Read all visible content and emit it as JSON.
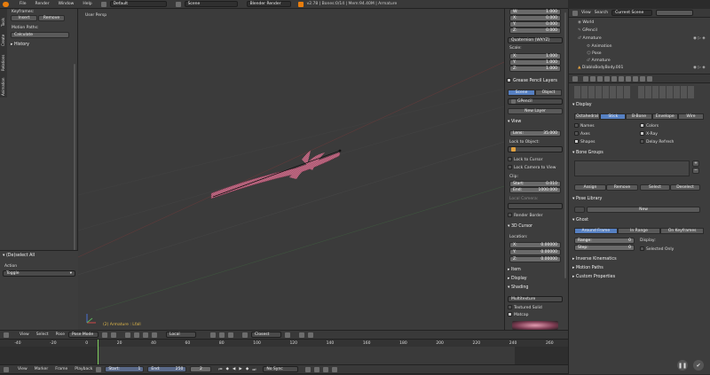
{
  "info_bar": {
    "menu": [
      "File",
      "Render",
      "Window",
      "Help"
    ],
    "layout_name": "Default",
    "scene_name": "Scene",
    "render_engine": "Blender Render",
    "stats": "v2.78 | Bones:0/14 | Mem:94.40M | Armature"
  },
  "tool_shelf": {
    "keyframes_label": "Keyframes:",
    "insert": "Insert",
    "remove": "Remove",
    "motion_paths_label": "Motion Paths:",
    "calculate": "Calculate",
    "history": "History",
    "tabs": [
      "Tools",
      "Create",
      "Relations",
      "Animation"
    ]
  },
  "operator_panel": {
    "title": "(De)select All",
    "action_label": "Action",
    "action_value": "Toggle"
  },
  "viewport": {
    "label": "User Persp",
    "object_label": "(2) Armature : Lfall"
  },
  "properties_n": {
    "rot_w": "W:",
    "rot_w_val": "1.000",
    "rot_x": "X:",
    "rot_x_val": "0.000",
    "rot_y": "Y:",
    "rot_y_val": "0.000",
    "rot_z": "Z:",
    "rot_z_val": "0.000",
    "rotation_mode": "Quaternion (WXYZ)",
    "scale_label": "Scale:",
    "scale_x": "X:",
    "scale_x_val": "1.000",
    "scale_y": "Y:",
    "scale_y_val": "1.000",
    "scale_z": "Z:",
    "scale_z_val": "1.000",
    "grease_pencil": "Grease Pencil Layers",
    "scene_tab": "Scene",
    "object_tab": "Object",
    "gpencil_name": "GPencil",
    "new_layer": "New Layer",
    "view_section": "View",
    "lens_label": "Lens:",
    "lens_value": "35.000",
    "lock_to_object": "Lock to Object:",
    "lock_to_cursor": "Lock to Cursor",
    "lock_camera": "Lock Camera to View",
    "clip_label": "Clip:",
    "clip_start": "Start:",
    "clip_start_val": "0.010",
    "clip_end": "End:",
    "clip_end_val": "1000.000",
    "local_camera": "Local Camera:",
    "render_border": "Render Border",
    "cursor_section": "3D Cursor",
    "location_label": "Location:",
    "cursor_x": "X:",
    "cursor_x_val": "0.00000",
    "cursor_y": "Y:",
    "cursor_y_val": "0.00000",
    "cursor_z": "Z:",
    "cursor_z_val": "0.00000",
    "item_section": "Item",
    "display_section": "Display",
    "shading_section": "Shading",
    "shading_mode": "Multitexture",
    "textured_solid": "Textured Solid",
    "matcap": "Matcap"
  },
  "outliner": {
    "view": "View",
    "search": "Search",
    "scene_filter": "Current Scene",
    "items": [
      "World",
      "GPencil",
      "Armature",
      "Animation",
      "Pose",
      "Armature",
      "DiabloBodyBody.001"
    ]
  },
  "properties": {
    "display_section": "Display",
    "draw_tabs": [
      "Octahedral",
      "Stick",
      "B-Bone",
      "Envelope",
      "Wire"
    ],
    "names": "Names",
    "axes": "Axes",
    "shapes": "Shapes",
    "colors": "Colors",
    "xray": "X-Ray",
    "delay_refresh": "Delay Refresh",
    "bone_groups_section": "Bone Groups",
    "assign": "Assign",
    "remove": "Remove",
    "select": "Select",
    "deselect": "Deselect",
    "pose_library_section": "Pose Library",
    "new": "New",
    "ghost_section": "Ghost",
    "ghost_tabs": [
      "Around Frame",
      "In Range",
      "On Keyframes"
    ],
    "range_label": "Range:",
    "range_val": "0",
    "step_label": "Step:",
    "step_val": "0",
    "display_label": "Display:",
    "selected_only": "Selected Only",
    "ik_section": "Inverse Kinematics",
    "motion_paths_section": "Motion Paths",
    "custom_props_section": "Custom Properties"
  },
  "view_header": {
    "view": "View",
    "select": "Select",
    "pose": "Pose",
    "mode": "Pose Mode",
    "pivot": "Local",
    "snap": "Closest"
  },
  "timeline": {
    "ticks": [
      "-40",
      "-20",
      "0",
      "20",
      "40",
      "60",
      "80",
      "100",
      "120",
      "140",
      "160",
      "180",
      "200",
      "220",
      "240",
      "260"
    ],
    "view": "View",
    "marker": "Marker",
    "frame": "Frame",
    "playback": "Playback",
    "start_label": "Start:",
    "start_val": "1",
    "end_label": "End:",
    "end_val": "250",
    "current_frame": "2",
    "sync": "No Sync"
  }
}
